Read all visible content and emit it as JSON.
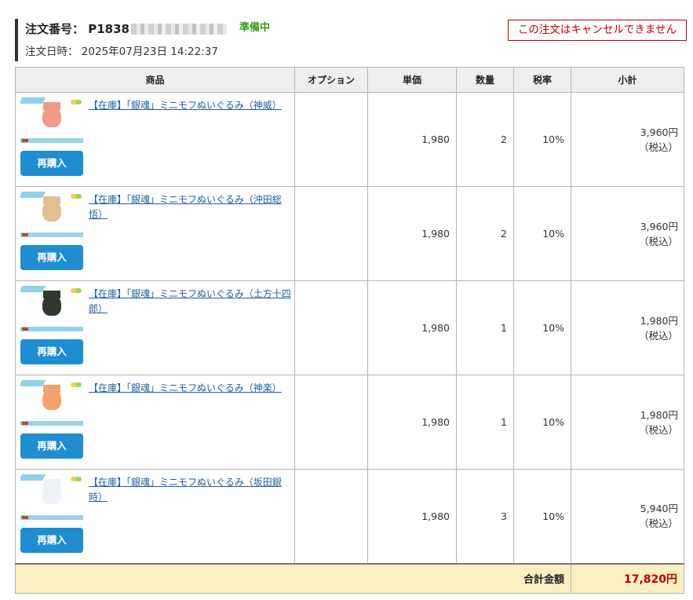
{
  "order": {
    "number_label": "注文番号：",
    "number_prefix": "P1838",
    "status": "準備中",
    "date_label": "注文日時：",
    "date_value": "2025年07月23日 14:22:37",
    "cancel_note": "この注文はキャンセルできません"
  },
  "table": {
    "headers": [
      "商品",
      "オプション",
      "単価",
      "数量",
      "税率",
      "小計"
    ],
    "rows": [
      {
        "name": "【在庫】「銀魂」ミニモフぬいぐるみ（神威）",
        "option": "",
        "unit_price": "1,980",
        "qty": "2",
        "tax": "10%",
        "subtotal": "3,960円",
        "tax_note": "（税込）",
        "rebuy": "再購入",
        "thumb_color": "#f29a8a"
      },
      {
        "name": "【在庫】「銀魂」ミニモフぬいぐるみ（沖田総悟）",
        "option": "",
        "unit_price": "1,980",
        "qty": "2",
        "tax": "10%",
        "subtotal": "3,960円",
        "tax_note": "（税込）",
        "rebuy": "再購入",
        "thumb_color": "#e3c08f"
      },
      {
        "name": "【在庫】「銀魂」ミニモフぬいぐるみ（土方十四郎）",
        "option": "",
        "unit_price": "1,980",
        "qty": "1",
        "tax": "10%",
        "subtotal": "1,980円",
        "tax_note": "（税込）",
        "rebuy": "再購入",
        "thumb_color": "#2f3a2c"
      },
      {
        "name": "【在庫】「銀魂」ミニモフぬいぐるみ（神楽）",
        "option": "",
        "unit_price": "1,980",
        "qty": "1",
        "tax": "10%",
        "subtotal": "1,980円",
        "tax_note": "（税込）",
        "rebuy": "再購入",
        "thumb_color": "#f2a36a"
      },
      {
        "name": "【在庫】「銀魂」ミニモフぬいぐるみ（坂田銀時）",
        "option": "",
        "unit_price": "1,980",
        "qty": "3",
        "tax": "10%",
        "subtotal": "5,940円",
        "tax_note": "（税込）",
        "rebuy": "再購入",
        "thumb_color": "#eef2f8"
      }
    ],
    "total_label": "合計金額",
    "total_value": "17,820円"
  }
}
